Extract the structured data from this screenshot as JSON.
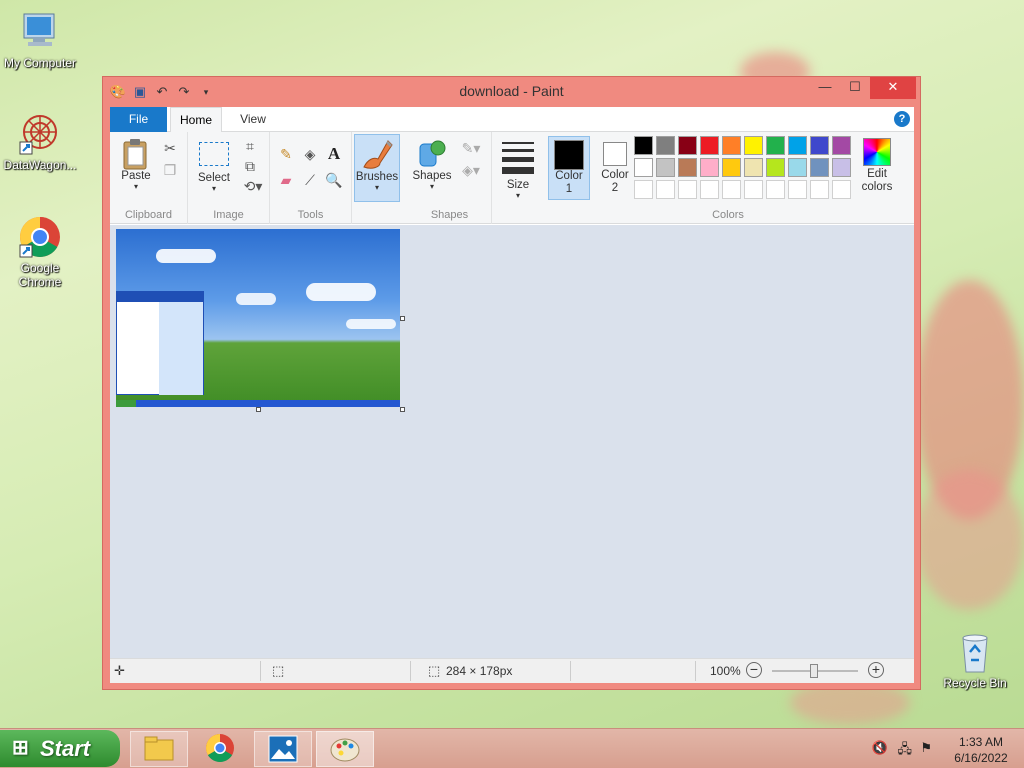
{
  "desktop": {
    "icons": [
      {
        "label": "My Computer",
        "icon": "computer-icon"
      },
      {
        "label": "DataWagon...",
        "icon": "datawagon-icon"
      },
      {
        "label": "Google Chrome",
        "icon": "chrome-icon"
      },
      {
        "label": "Recycle Bin",
        "icon": "recycle-bin-icon"
      }
    ]
  },
  "window": {
    "title": "download - Paint",
    "tabs": {
      "file": "File",
      "home": "Home",
      "view": "View"
    },
    "help": "?"
  },
  "ribbon": {
    "clipboard": {
      "label": "Clipboard",
      "paste": "Paste"
    },
    "image": {
      "label": "Image",
      "select": "Select"
    },
    "tools": {
      "label": "Tools"
    },
    "brushes": {
      "label": "Brushes"
    },
    "shapes": {
      "label": "Shapes",
      "button": "Shapes"
    },
    "size": {
      "label": "Size"
    },
    "colors": {
      "label": "Colors",
      "color1": "Color",
      "color1_num": "1",
      "color2": "Color",
      "color2_num": "2",
      "edit1": "Edit",
      "edit2": "colors",
      "color1_value": "#000000",
      "color2_value": "#ffffff",
      "palette_row1": [
        "#000000",
        "#7f7f7f",
        "#880015",
        "#ed1c24",
        "#ff7f27",
        "#fff200",
        "#22b14c",
        "#00a2e8",
        "#3f48cc",
        "#a349a4"
      ],
      "palette_row2": [
        "#ffffff",
        "#c3c3c3",
        "#b97a57",
        "#ffaec9",
        "#ffc90e",
        "#efe4b0",
        "#b5e61d",
        "#99d9ea",
        "#7092be",
        "#c8bfe7"
      ],
      "palette_row3": [
        "#ffffff",
        "#ffffff",
        "#ffffff",
        "#ffffff",
        "#ffffff",
        "#ffffff",
        "#ffffff",
        "#ffffff",
        "#ffffff",
        "#ffffff"
      ]
    }
  },
  "status": {
    "dimensions": "284 × 178px",
    "zoom": "100%",
    "zoom_level_percent": 100
  },
  "taskbar": {
    "start": "Start",
    "time": "1:33 AM",
    "date": "6/16/2022"
  }
}
